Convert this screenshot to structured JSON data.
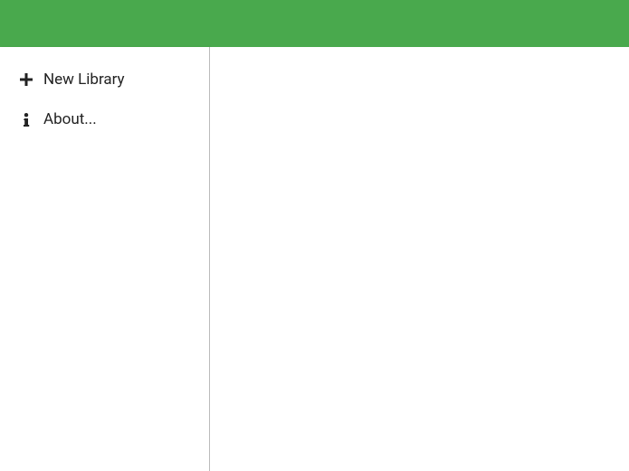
{
  "sidebar": {
    "items": [
      {
        "label": "New Library",
        "icon": "plus-icon"
      },
      {
        "label": "About...",
        "icon": "info-icon"
      }
    ]
  }
}
